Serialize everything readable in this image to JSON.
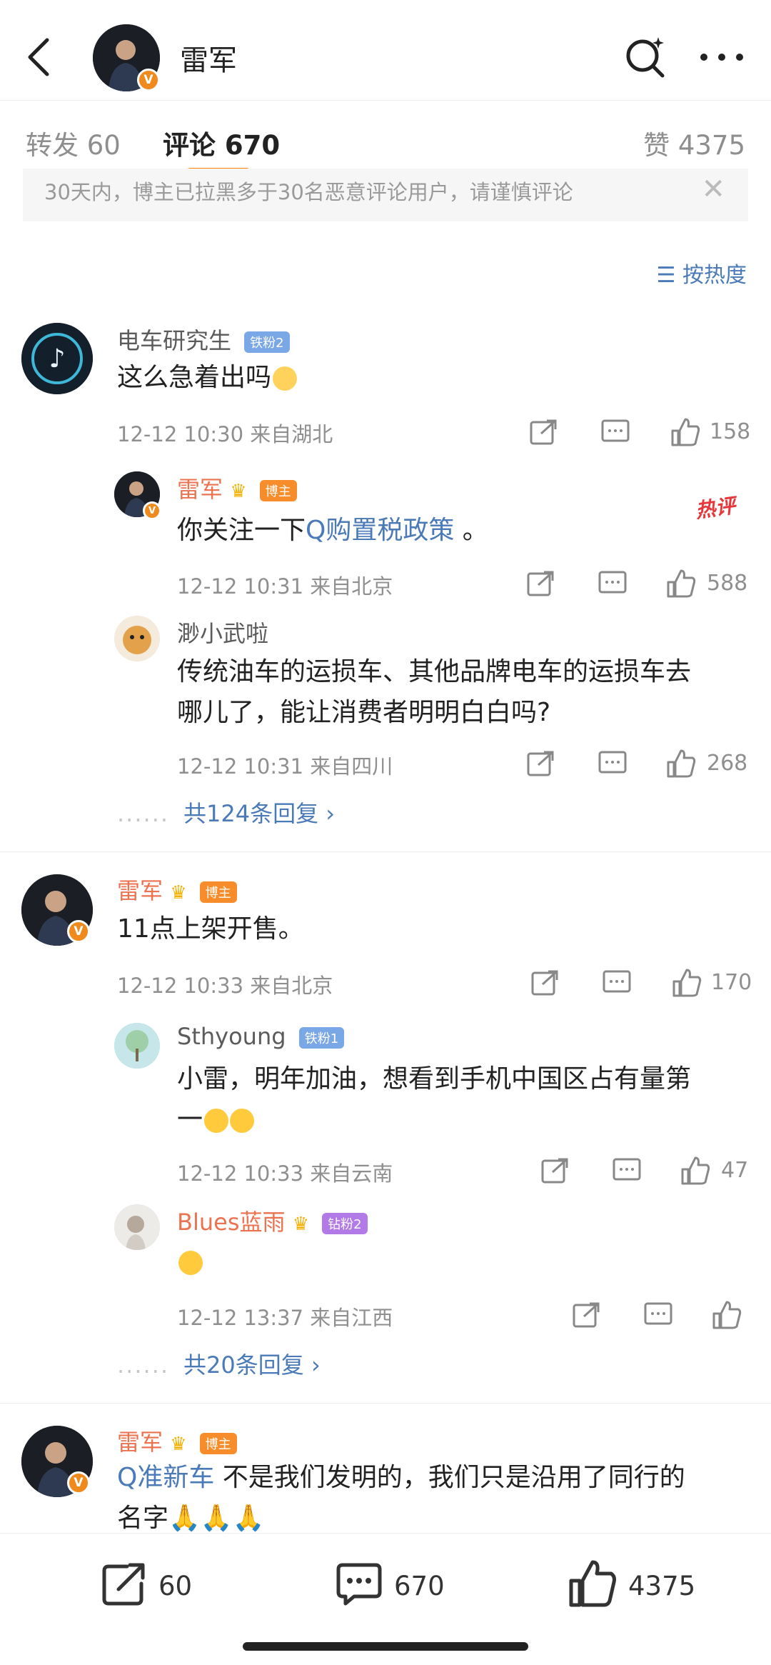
{
  "header": {
    "title": "雷军"
  },
  "tabs": {
    "repost_label": "转发",
    "repost_count": "60",
    "comments_label": "评论",
    "comments_count": "670",
    "likes_label": "赞",
    "likes_count": "4375"
  },
  "notice": {
    "text": "30天内，博主已拉黑多于30名恶意评论用户，请谨慎评论"
  },
  "sort": {
    "label": "按热度"
  },
  "comments": [
    {
      "name": "电车研究生",
      "badge": "铁粉2",
      "text": "这么急着出吗",
      "time": "12-12 10:30",
      "location": "来自湖北",
      "likes": "158",
      "replies": [
        {
          "name": "雷军",
          "badge": "博主",
          "text_pre": "你关注一下",
          "topic": "Q购置税政策",
          "text_post": " 。",
          "hot": "热评",
          "time": "12-12 10:31",
          "location": "来自北京",
          "likes": "588"
        },
        {
          "name": "渺小武啦",
          "text_line1": "传统油车的运损车、其他品牌电车的运损车去",
          "text_line2": "哪儿了，能让消费者明明白白吗?",
          "time": "12-12 10:31",
          "location": "来自四川",
          "likes": "268"
        }
      ],
      "more_replies": "共124条回复"
    },
    {
      "name": "雷军",
      "badge": "博主",
      "text": "11点上架开售。",
      "time": "12-12 10:33",
      "location": "来自北京",
      "likes": "170",
      "replies": [
        {
          "name": "Sthyoung",
          "badge": "铁粉1",
          "text_line1": "小雷，明年加油，想看到手机中国区占有量第",
          "text_line2": "一",
          "time": "12-12 10:33",
          "location": "来自云南",
          "likes": "47"
        },
        {
          "name": "Blues蓝雨",
          "badge": "钻粉2",
          "time": "12-12 13:37",
          "location": "来自江西"
        }
      ],
      "more_replies": "共20条回复"
    },
    {
      "name": "雷军",
      "badge": "博主",
      "topic": "Q准新车",
      "text_line1": " 不是我们发明的，我们只是沿用了同行的",
      "text_line2": "名字"
    }
  ],
  "bottom": {
    "repost_count": "60",
    "comment_count": "670",
    "like_count": "4375"
  },
  "colors": {
    "accent": "#ff8200",
    "link": "#4a7ab8",
    "vip_name": "#eb7350"
  }
}
